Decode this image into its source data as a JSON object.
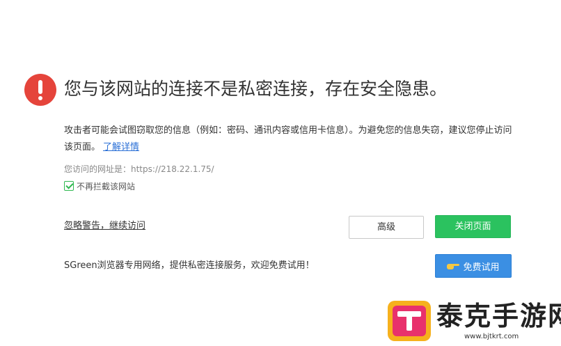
{
  "warning": {
    "icon": "exclamation-icon",
    "icon_color": "#e5443b",
    "title": "您与该网站的连接不是私密连接，存在安全隐患。",
    "description": "攻击者可能会试图窃取您的信息（例如：密码、通讯内容或信用卡信息）。为避免您的信息失窃，建议您停止访问该页面。",
    "learn_more": "了解详情",
    "url_label": "您访问的网址是：https://218.22.1.75/",
    "checkbox_label": "不再拦截该网站",
    "checkbox_checked": true
  },
  "actions": {
    "ignore_link": "忽略警告，继续访问",
    "advanced_label": "高级",
    "close_label": "关闭页面",
    "close_color": "#2bc25f"
  },
  "promo": {
    "text": "SGreen浏览器专用网络，提供私密连接服务，欢迎免费试用！",
    "trial_label": "免费试用",
    "trial_icon": "pointing-hand-icon",
    "trial_color": "#3b8fe3"
  },
  "watermark": {
    "logo_icon": "t-logo-icon",
    "text": "泰克手游网",
    "url": "www.bjtkrt.com"
  }
}
